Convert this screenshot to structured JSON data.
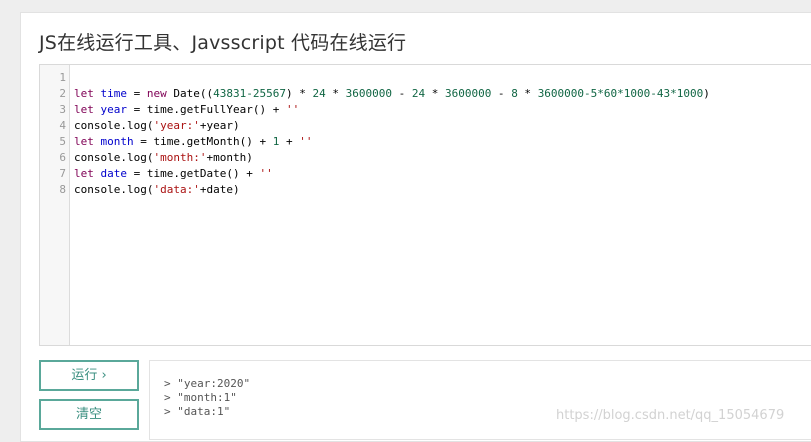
{
  "page": {
    "title": "JS在线运行工具、Javsscript 代码在线运行"
  },
  "editor": {
    "line_numbers": [
      "1",
      "2",
      "3",
      "4",
      "5",
      "6",
      "7",
      "8"
    ],
    "lines": [
      [],
      [
        {
          "t": "let",
          "c": "kw"
        },
        {
          "t": " ",
          "c": "op"
        },
        {
          "t": "time",
          "c": "vr"
        },
        {
          "t": " = ",
          "c": "op"
        },
        {
          "t": "new",
          "c": "kw"
        },
        {
          "t": " Date((",
          "c": "op"
        },
        {
          "t": "43831-25567",
          "c": "nm"
        },
        {
          "t": ") * ",
          "c": "op"
        },
        {
          "t": "24",
          "c": "nm"
        },
        {
          "t": " * ",
          "c": "op"
        },
        {
          "t": "3600000",
          "c": "nm"
        },
        {
          "t": " - ",
          "c": "op"
        },
        {
          "t": "24",
          "c": "nm"
        },
        {
          "t": " * ",
          "c": "op"
        },
        {
          "t": "3600000",
          "c": "nm"
        },
        {
          "t": " - ",
          "c": "op"
        },
        {
          "t": "8",
          "c": "nm"
        },
        {
          "t": " * ",
          "c": "op"
        },
        {
          "t": "3600000-5*60*1000-43*1000",
          "c": "nm"
        },
        {
          "t": ")",
          "c": "op"
        }
      ],
      [
        {
          "t": "let",
          "c": "kw"
        },
        {
          "t": " ",
          "c": "op"
        },
        {
          "t": "year",
          "c": "vr"
        },
        {
          "t": " = time.getFullYear() + ",
          "c": "op"
        },
        {
          "t": "''",
          "c": "st"
        }
      ],
      [
        {
          "t": "console.log(",
          "c": "op"
        },
        {
          "t": "'year:'",
          "c": "st"
        },
        {
          "t": "+year)",
          "c": "op"
        }
      ],
      [
        {
          "t": "let",
          "c": "kw"
        },
        {
          "t": " ",
          "c": "op"
        },
        {
          "t": "month",
          "c": "vr"
        },
        {
          "t": " = time.getMonth() + ",
          "c": "op"
        },
        {
          "t": "1",
          "c": "nm"
        },
        {
          "t": " + ",
          "c": "op"
        },
        {
          "t": "''",
          "c": "st"
        }
      ],
      [
        {
          "t": "console.log(",
          "c": "op"
        },
        {
          "t": "'month:'",
          "c": "st"
        },
        {
          "t": "+month)",
          "c": "op"
        }
      ],
      [
        {
          "t": "let",
          "c": "kw"
        },
        {
          "t": " ",
          "c": "op"
        },
        {
          "t": "date",
          "c": "vr"
        },
        {
          "t": " = time.getDate() + ",
          "c": "op"
        },
        {
          "t": "''",
          "c": "st"
        }
      ],
      [
        {
          "t": "console.log(",
          "c": "op"
        },
        {
          "t": "'data:'",
          "c": "st"
        },
        {
          "t": "+date)",
          "c": "op"
        }
      ]
    ]
  },
  "buttons": {
    "run_label": "运行 ›",
    "clear_label": "清空"
  },
  "output": {
    "lines": [
      "> \"year:2020\"",
      "> \"month:1\"",
      "> \"data:1\""
    ]
  },
  "watermark": "https://blog.csdn.net/qq_15054679",
  "colors": {
    "accent": "#5aa89a",
    "keyword": "#7f0055",
    "variable": "#0000cc",
    "number": "#116644",
    "string": "#aa1111"
  }
}
